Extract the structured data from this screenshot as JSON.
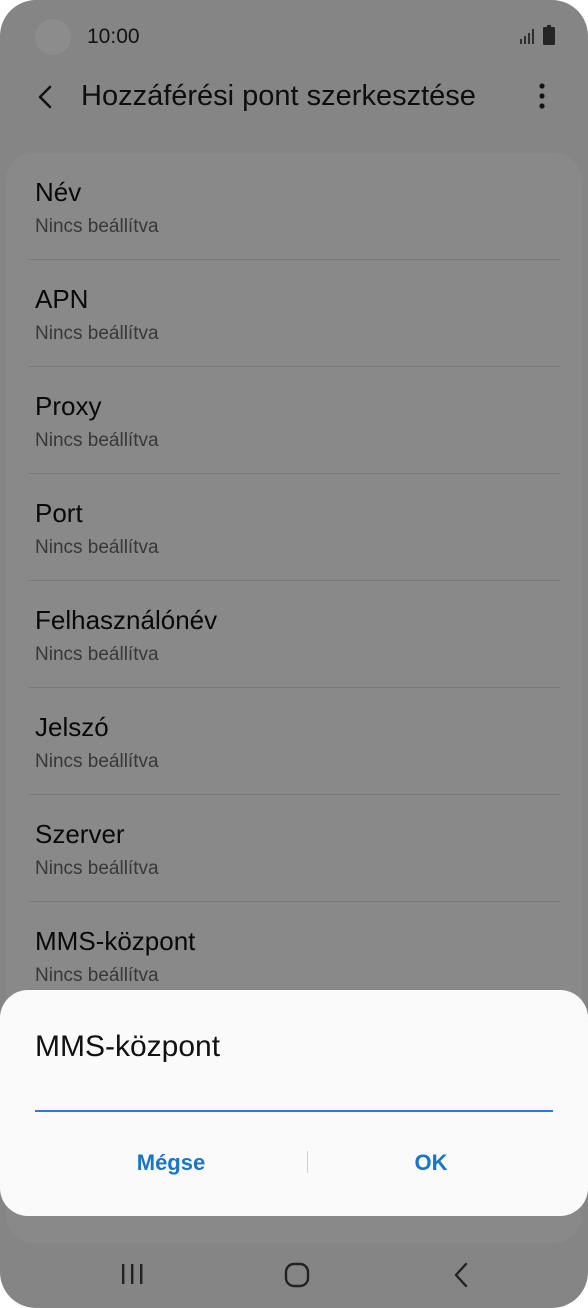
{
  "status_bar": {
    "time": "10:00",
    "icons": [
      "camera-cutout",
      "signal-icon",
      "battery-icon"
    ]
  },
  "header": {
    "title": "Hozzáférési pont szerkesztése",
    "back_icon": "back-arrow-icon",
    "menu_icon": "more-options-icon"
  },
  "settings": {
    "items": [
      {
        "title": "Név",
        "value": "Nincs beállítva"
      },
      {
        "title": "APN",
        "value": "Nincs beállítva"
      },
      {
        "title": "Proxy",
        "value": "Nincs beállítva"
      },
      {
        "title": "Port",
        "value": "Nincs beállítva"
      },
      {
        "title": "Felhasználónév",
        "value": "Nincs beállítva"
      },
      {
        "title": "Jelszó",
        "value": "Nincs beállítva"
      },
      {
        "title": "Szerver",
        "value": "Nincs beállítva"
      },
      {
        "title": "MMS-központ",
        "value": "Nincs beállítva"
      }
    ]
  },
  "dialog": {
    "title": "MMS-központ",
    "input_value": "",
    "cancel_label": "Mégse",
    "ok_label": "OK"
  },
  "nav_bar": {
    "icons": [
      "recent-apps-icon",
      "home-icon",
      "back-icon"
    ]
  },
  "colors": {
    "accent": "#1a74c9",
    "input_underline": "#2a7bd1",
    "scrim": "rgba(0,0,0,0.45)"
  }
}
